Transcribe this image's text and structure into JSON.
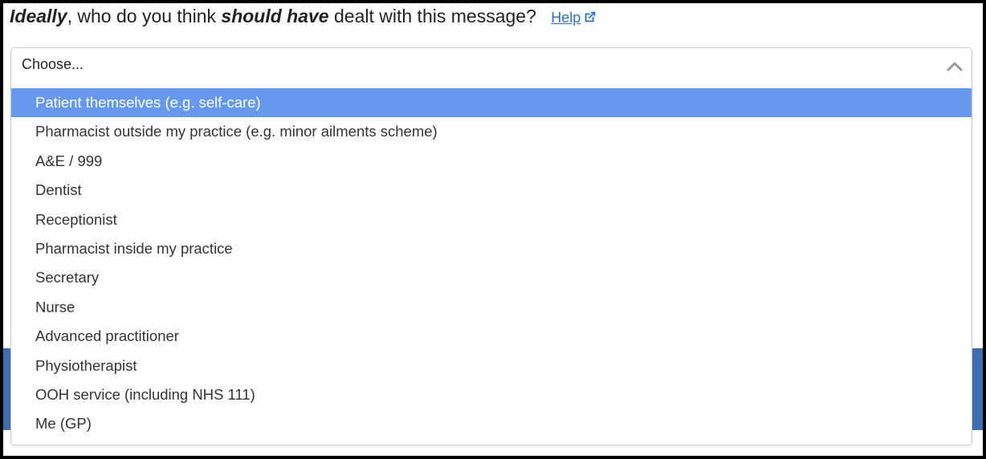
{
  "question": {
    "part1": "Ideally",
    "part2": ", who do you think ",
    "part3": "should have",
    "part4": " dealt with this message?",
    "help_label": "Help"
  },
  "select": {
    "value": "Choose...",
    "options": [
      {
        "label": "Patient themselves (e.g. self-care)",
        "highlighted": true
      },
      {
        "label": "Pharmacist outside my practice (e.g. minor ailments scheme)"
      },
      {
        "label": "A&E / 999"
      },
      {
        "label": "Dentist"
      },
      {
        "label": "Receptionist"
      },
      {
        "label": "Pharmacist inside my practice"
      },
      {
        "label": "Secretary"
      },
      {
        "label": "Nurse"
      },
      {
        "label": "Advanced practitioner"
      },
      {
        "label": "Physiotherapist"
      },
      {
        "label": "OOH service (including NHS 111)"
      },
      {
        "label": "Me (GP)"
      }
    ]
  },
  "colors": {
    "highlight": "#6699ee",
    "link": "#2a73c6",
    "background_banner": "#3d6fb0"
  },
  "icons": [
    "external-link-icon",
    "chevron-up-icon"
  ]
}
